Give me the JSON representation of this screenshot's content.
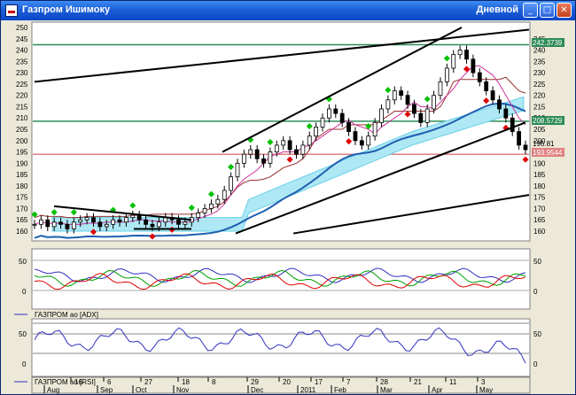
{
  "window": {
    "title": "Газпром Ишимоку",
    "timeframe": "Дневной",
    "buttons": {
      "minimize": "_",
      "maximize": "□",
      "close": "✕"
    }
  },
  "colors": {
    "background": "#ffffff",
    "frame": "#ece9d8",
    "up_marker": "#00c000",
    "down_marker": "#e00000",
    "tenkan": "#cc3399",
    "kijun": "#9a3030",
    "cloud": "#66d0e8",
    "ma": "#1f5fb0",
    "hline": "#2e8b57",
    "hline_red": "#e08080"
  },
  "main_chart": {
    "yticks": [
      160,
      165,
      170,
      175,
      180,
      185,
      190,
      195,
      200,
      205,
      210,
      215,
      220,
      225,
      230,
      235,
      240,
      245,
      250
    ],
    "right_ticks": [
      160,
      165,
      170,
      175,
      180,
      185,
      190,
      195,
      200,
      205,
      210,
      215,
      220,
      225,
      230,
      235,
      240,
      245
    ],
    "badges": {
      "upper_level": "242.3739",
      "mid_level": "208.5729",
      "last_price": "196.81",
      "lower_level": "193.9544"
    },
    "levels": {
      "upper": 242.37,
      "mid": 208.57,
      "last": 196.81,
      "lower": 193.95
    }
  },
  "adx_panel": {
    "ticks_left": [
      "50",
      "0"
    ],
    "ticks_right": [
      "50",
      "0"
    ],
    "legend": "ГАЗПРОМ ао [ADX]"
  },
  "rsi_panel": {
    "ticks_left": [
      "50",
      "0"
    ],
    "ticks_right": [
      "50",
      "0"
    ],
    "legend": "ГАЗПРОМ ао [RSI]"
  },
  "x_axis": {
    "days": [
      "16",
      "6",
      "27",
      "18",
      "8",
      "29",
      "20",
      "17",
      "7",
      "28",
      "21",
      "11",
      "3"
    ],
    "months": [
      "Aug",
      "Sep",
      "Oct",
      "Nov",
      "Dec",
      "2011",
      "Feb",
      "Mar",
      "Apr",
      "May"
    ]
  },
  "chart_data": {
    "type": "line",
    "series_price_close": [
      163,
      165,
      162,
      164,
      163,
      161,
      164,
      165,
      166,
      164,
      162,
      163,
      165,
      164,
      166,
      167,
      165,
      163,
      162,
      164,
      166,
      165,
      163,
      164,
      166,
      168,
      170,
      172,
      174,
      178,
      184,
      190,
      194,
      196,
      192,
      190,
      195,
      198,
      200,
      196,
      194,
      198,
      202,
      206,
      210,
      214,
      212,
      208,
      204,
      200,
      198,
      202,
      208,
      214,
      218,
      222,
      220,
      216,
      212,
      208,
      214,
      220,
      226,
      232,
      238,
      240,
      236,
      230,
      226,
      222,
      218,
      214,
      210,
      204,
      198,
      196
    ]
  }
}
